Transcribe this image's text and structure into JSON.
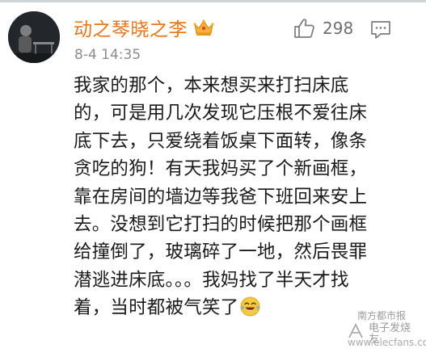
{
  "comment": {
    "username": "动之琴晓之李",
    "timestamp": "8-4 14:35",
    "like_count": "298",
    "lines": [
      "我家的那个，本来想买来打扫床底",
      "的，可是用几次发现它压根不爱往床",
      "底下去，只爱绕着饭桌下面转，像条",
      "贪吃的狗！有天我妈买了个新画框，",
      "靠在房间的墙边等我爸下班回来安上",
      "去。没想到它打扫的时候把那个画框",
      "给撞倒了，玻璃碎了一地，然后畏罪",
      "潜逃进床底。。。我妈找了半天才找",
      "着，当时都被气笑了"
    ]
  },
  "watermark": {
    "source": "南方都市报",
    "brand": "电子发烧友",
    "url": "www.elecfans.com"
  },
  "colors": {
    "username": "#e4761c",
    "timestamp": "#8c8c8c",
    "text": "#1b1b1b",
    "icons": "#7a7a7a"
  }
}
